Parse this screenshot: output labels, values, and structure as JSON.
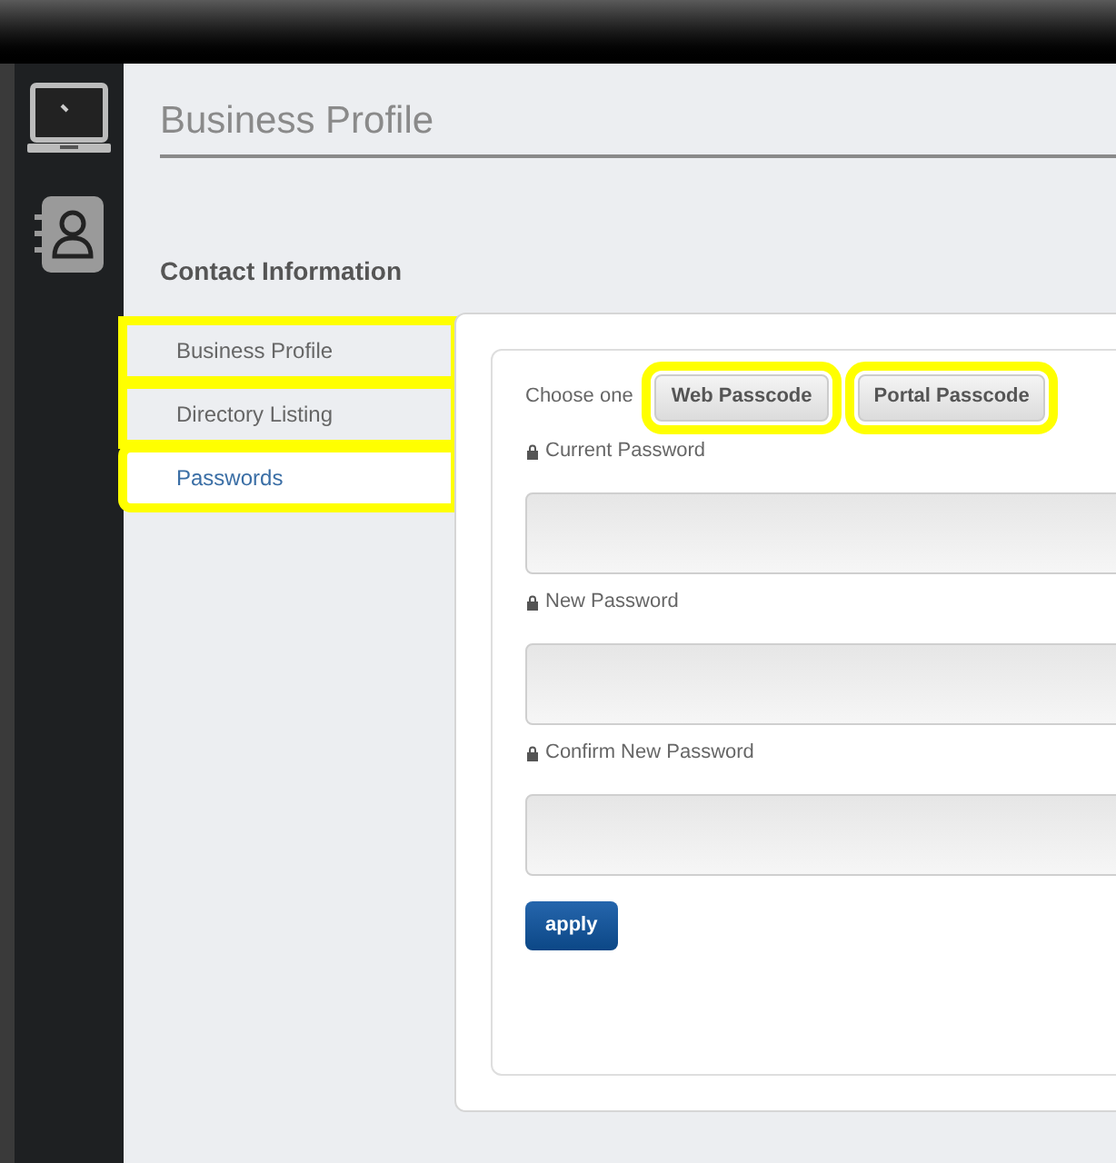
{
  "page_title": "Business Profile",
  "section_title": "Contact Information",
  "nav_items": [
    {
      "label": "Business Profile",
      "selected": false,
      "highlighted": true
    },
    {
      "label": "Directory Listing",
      "selected": false,
      "highlighted": true
    },
    {
      "label": "Passwords",
      "selected": true,
      "highlighted": true
    }
  ],
  "chooser": {
    "label": "Choose one",
    "options": [
      {
        "label": "Web Passcode",
        "highlighted": true
      },
      {
        "label": "Portal Passcode",
        "highlighted": true
      }
    ]
  },
  "fields": [
    {
      "label": "Current Password"
    },
    {
      "label": "New Password"
    },
    {
      "label": "Confirm New Password"
    }
  ],
  "apply_button": "apply"
}
